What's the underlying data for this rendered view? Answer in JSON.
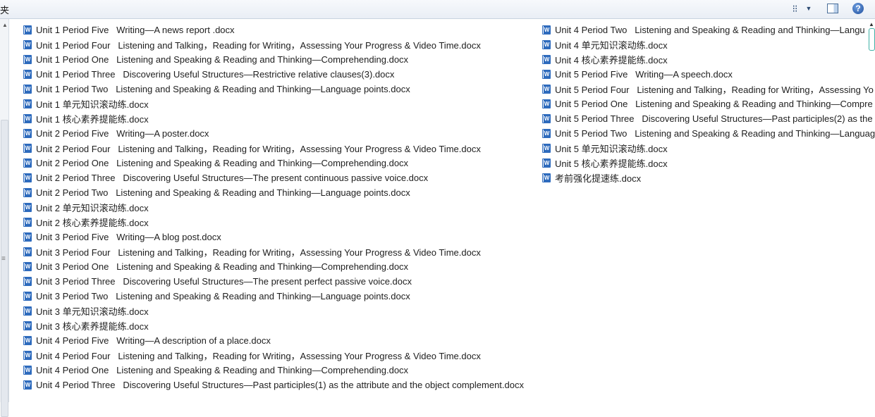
{
  "toolbar": {
    "crumb": "夹",
    "view_glyph": "⁝⁝",
    "view_arrow": "▼",
    "help_glyph": "?"
  },
  "files_col1": [
    "Unit 1 Period Five   Writing—A news report .docx",
    "Unit 1 Period Four   Listening and Talking，Reading for Writing，Assessing Your Progress & Video Time.docx",
    "Unit 1 Period One   Listening and Speaking & Reading and Thinking—Comprehending.docx",
    "Unit 1 Period Three   Discovering Useful Structures—Restrictive relative clauses(3).docx",
    "Unit 1 Period Two   Listening and Speaking & Reading and Thinking—Language points.docx",
    "Unit 1 单元知识滚动练.docx",
    "Unit 1 核心素养提能练.docx",
    "Unit 2 Period Five   Writing—A poster.docx",
    "Unit 2 Period Four   Listening and Talking，Reading for Writing，Assessing Your Progress & Video Time.docx",
    "Unit 2 Period One   Listening and Speaking & Reading and Thinking—Comprehending.docx",
    "Unit 2 Period Three   Discovering Useful Structures—The present continuous passive voice.docx",
    "Unit 2 Period Two   Listening and Speaking & Reading and Thinking—Language points.docx",
    "Unit 2 单元知识滚动练.docx",
    "Unit 2 核心素养提能练.docx",
    "Unit 3 Period Five   Writing—A blog post.docx",
    "Unit 3 Period Four   Listening and Talking，Reading for Writing，Assessing Your Progress & Video Time.docx",
    "Unit 3 Period One   Listening and Speaking & Reading and Thinking—Comprehending.docx",
    "Unit 3 Period Three   Discovering Useful Structures—The present perfect passive voice.docx",
    "Unit 3 Period Two   Listening and Speaking & Reading and Thinking—Language points.docx",
    "Unit 3 单元知识滚动练.docx",
    "Unit 3 核心素养提能练.docx",
    "Unit 4 Period Five   Writing—A description of a place.docx",
    "Unit 4 Period Four   Listening and Talking，Reading for Writing，Assessing Your Progress & Video Time.docx",
    "Unit 4 Period One   Listening and Speaking & Reading and Thinking—Comprehending.docx",
    "Unit 4 Period Three   Discovering Useful Structures—Past participles(1) as the attribute and the object complement.docx"
  ],
  "files_col2": [
    "Unit 4 Period Two   Listening and Speaking & Reading and Thinking—Langu",
    "Unit 4 单元知识滚动练.docx",
    "Unit 4 核心素养提能练.docx",
    "Unit 5 Period Five   Writing—A speech.docx",
    "Unit 5 Period Four   Listening and Talking，Reading for Writing，Assessing Yo",
    "Unit 5 Period One   Listening and Speaking & Reading and Thinking—Compre",
    "Unit 5 Period Three   Discovering Useful Structures—Past participles(2) as the",
    "Unit 5 Period Two   Listening and Speaking & Reading and Thinking—Languag",
    "Unit 5 单元知识滚动练.docx",
    "Unit 5 核心素养提能练.docx",
    "考前强化提速练.docx"
  ]
}
